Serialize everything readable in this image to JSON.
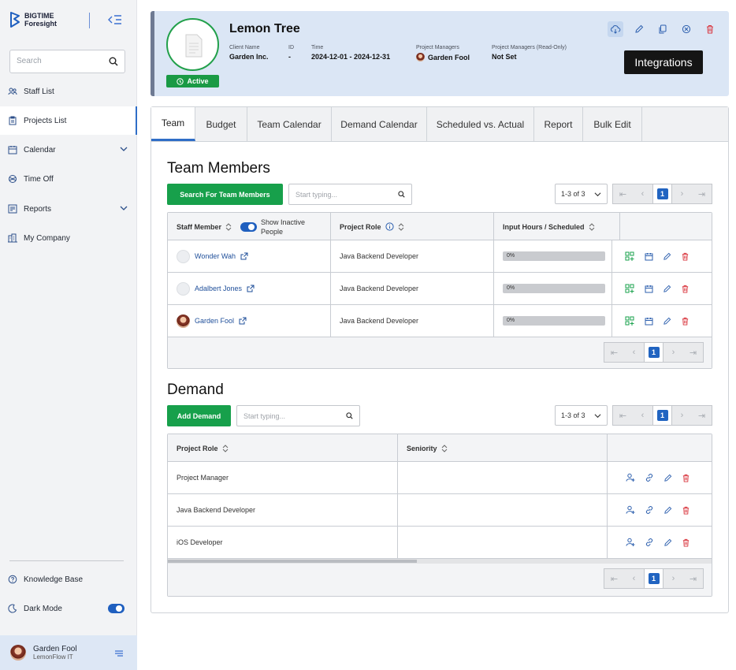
{
  "app": {
    "brand_line1": "BIGTIME",
    "brand_line2": "Foresight"
  },
  "sidebar": {
    "search_placeholder": "Search",
    "items": [
      {
        "label": "Staff List"
      },
      {
        "label": "Projects List"
      },
      {
        "label": "Calendar"
      },
      {
        "label": "Time Off"
      },
      {
        "label": "Reports"
      },
      {
        "label": "My Company"
      }
    ],
    "knowledge_base": "Knowledge Base",
    "dark_mode": "Dark Mode",
    "user_name": "Garden Fool",
    "user_company": "LemonFlow IT"
  },
  "project": {
    "title": "Lemon Tree",
    "status": "Active",
    "client_label": "Client Name",
    "client": "Garden Inc.",
    "id_label": "ID",
    "id": "-",
    "time_label": "Time",
    "time": "2024-12-01 - 2024-12-31",
    "pm_label": "Project Managers",
    "pm": "Garden Fool",
    "pm_ro_label": "Project Managers (Read-Only)",
    "pm_ro": "Not Set",
    "tooltip": "Integrations"
  },
  "tabs": [
    "Team",
    "Budget",
    "Team Calendar",
    "Demand Calendar",
    "Scheduled vs. Actual",
    "Report",
    "Bulk Edit"
  ],
  "team": {
    "title": "Team Members",
    "search_button": "Search For Team Members",
    "placeholder": "Start typing...",
    "range": "1-3 of 3",
    "page": "1",
    "col_staff": "Staff Member",
    "show_inactive": "Show Inactive People",
    "col_role": "Project Role",
    "col_hours": "Input Hours / Scheduled",
    "rows": [
      {
        "name": "Wonder Wah",
        "role": "Java Backend Developer",
        "progress": "0%"
      },
      {
        "name": "Adalbert Jones",
        "role": "Java Backend Developer",
        "progress": "0%"
      },
      {
        "name": "Garden Fool",
        "role": "Java Backend Developer",
        "progress": "0%"
      }
    ]
  },
  "demand": {
    "title": "Demand",
    "add_button": "Add Demand",
    "placeholder": "Start typing...",
    "range": "1-3 of 3",
    "page": "1",
    "col_role": "Project Role",
    "col_seniority": "Seniority",
    "rows": [
      {
        "role": "Project Manager",
        "seniority": ""
      },
      {
        "role": "Java Backend Developer",
        "seniority": ""
      },
      {
        "role": "iOS Developer",
        "seniority": ""
      }
    ]
  },
  "colors": {
    "accent": "#2164c1",
    "green": "#17a04b",
    "danger": "#d9363e"
  }
}
